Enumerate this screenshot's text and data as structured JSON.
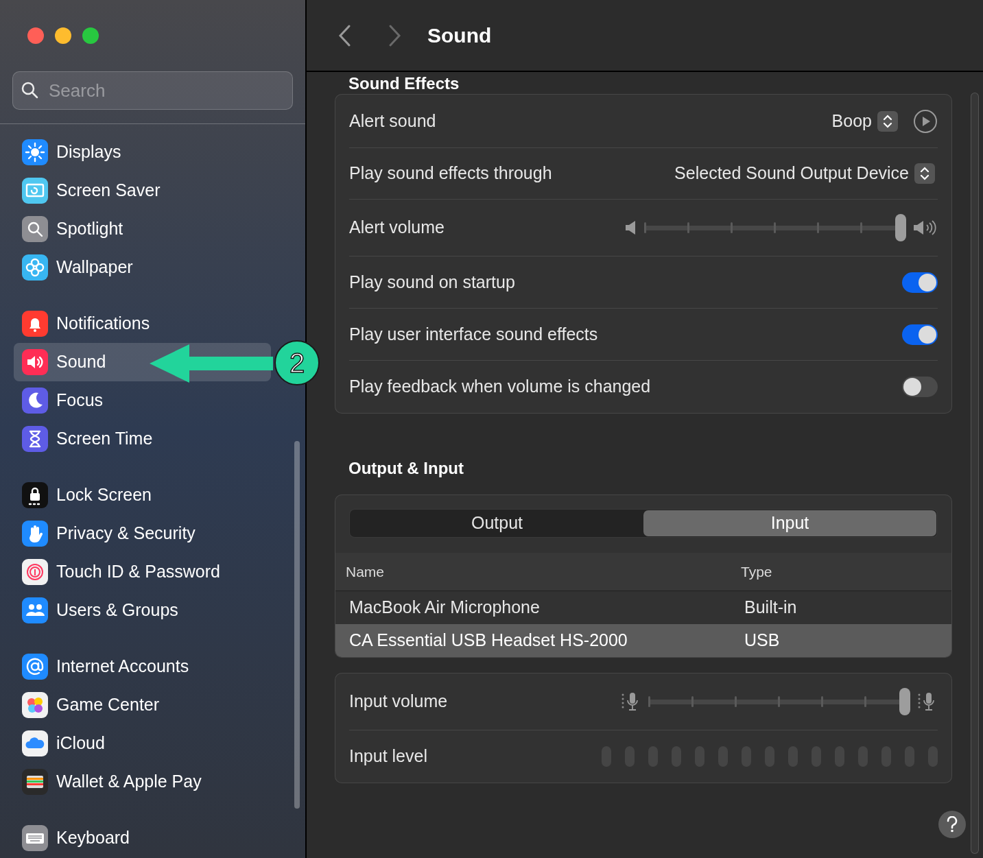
{
  "sidebar": {
    "search": {
      "placeholder": "Search"
    },
    "groups": [
      [
        {
          "label": "Displays",
          "selected": false
        },
        {
          "label": "Screen Saver",
          "selected": false
        },
        {
          "label": "Spotlight",
          "selected": false
        },
        {
          "label": "Wallpaper",
          "selected": false
        }
      ],
      [
        {
          "label": "Notifications",
          "selected": false
        },
        {
          "label": "Sound",
          "selected": true
        },
        {
          "label": "Focus",
          "selected": false
        },
        {
          "label": "Screen Time",
          "selected": false
        }
      ],
      [
        {
          "label": "Lock Screen",
          "selected": false
        },
        {
          "label": "Privacy & Security",
          "selected": false
        },
        {
          "label": "Touch ID & Password",
          "selected": false
        },
        {
          "label": "Users & Groups",
          "selected": false
        }
      ],
      [
        {
          "label": "Internet Accounts",
          "selected": false
        },
        {
          "label": "Game Center",
          "selected": false
        },
        {
          "label": "iCloud",
          "selected": false
        },
        {
          "label": "Wallet & Apple Pay",
          "selected": false
        }
      ],
      [
        {
          "label": "Keyboard",
          "selected": false
        }
      ]
    ]
  },
  "header": {
    "title": "Sound"
  },
  "sound_effects": {
    "heading": "Sound Effects",
    "rows": [
      {
        "kind": "popup",
        "label": "Alert sound",
        "value": "Boop",
        "play_button": true
      },
      {
        "kind": "popup",
        "label": "Play sound effects through",
        "value": "Selected Sound Output Device",
        "play_button": false
      },
      {
        "kind": "slider",
        "label": "Alert volume",
        "level": 1
      },
      {
        "kind": "toggle",
        "label": "Play sound on startup",
        "on": true
      },
      {
        "kind": "toggle",
        "label": "Play user interface sound effects",
        "on": true
      },
      {
        "kind": "toggle",
        "label": "Play feedback when volume is changed",
        "on": false
      }
    ]
  },
  "output_input": {
    "heading": "Output & Input",
    "tabs": [
      {
        "label": "Output",
        "selected": false
      },
      {
        "label": "Input",
        "selected": true
      }
    ],
    "columns": [
      "Name",
      "Type"
    ],
    "rows": [
      {
        "name": "MacBook Air Microphone",
        "type": "Built-in",
        "selected": false
      },
      {
        "name": "CA Essential USB Headset HS-2000",
        "type": "USB",
        "selected": true
      }
    ],
    "settings": [
      {
        "kind": "slider",
        "label": "Input volume",
        "level": 1
      },
      {
        "kind": "meter",
        "label": "Input level"
      }
    ]
  },
  "annotation": {
    "label": "2"
  }
}
